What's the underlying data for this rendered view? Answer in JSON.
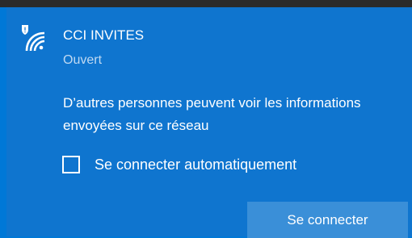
{
  "network": {
    "name": "CCI INVITES",
    "status": "Ouvert",
    "icon": "wifi-unsecured-icon"
  },
  "warning": {
    "text": "D’autres personnes peuvent voir les informations envoyées sur ce réseau"
  },
  "auto_connect": {
    "label": "Se connecter automatiquement",
    "checked": false
  },
  "actions": {
    "connect_label": "Se connecter"
  },
  "colors": {
    "panel": "#0f75cf",
    "accent": "#0078d7",
    "button": "#3a8fd8",
    "text": "#ffffff",
    "secondary_text": "#bfd9f2"
  }
}
